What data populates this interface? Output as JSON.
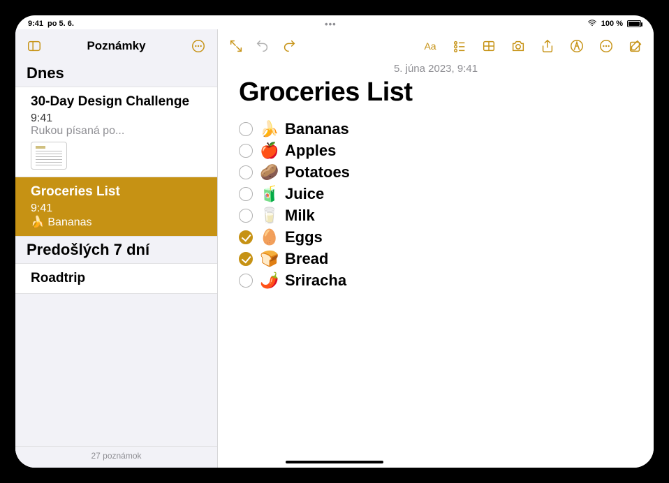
{
  "statusbar": {
    "time": "9:41",
    "date": "po 5. 6.",
    "battery_text": "100 %"
  },
  "sidebar": {
    "title": "Poznámky",
    "sections": [
      {
        "header": "Dnes",
        "items": [
          {
            "title": "30-Day Design Challenge",
            "time": "9:41",
            "preview": "Rukou písaná po...",
            "has_thumb": true,
            "selected": false
          },
          {
            "title": "Groceries List",
            "time": "9:41",
            "preview": "🍌 Bananas",
            "has_thumb": false,
            "selected": true
          }
        ]
      },
      {
        "header": "Predošlých 7 dní",
        "items": [
          {
            "title": "Roadtrip",
            "time": "",
            "preview": "",
            "has_thumb": false,
            "selected": false
          }
        ]
      }
    ],
    "footer": "27 poznámok"
  },
  "note": {
    "date": "5. júna 2023, 9:41",
    "title": "Groceries List",
    "items": [
      {
        "emoji": "🍌",
        "label": "Bananas",
        "checked": false
      },
      {
        "emoji": "🍎",
        "label": "Apples",
        "checked": false
      },
      {
        "emoji": "🥔",
        "label": "Potatoes",
        "checked": false
      },
      {
        "emoji": "🧃",
        "label": "Juice",
        "checked": false
      },
      {
        "emoji": "🥛",
        "label": "Milk",
        "checked": false
      },
      {
        "emoji": "🥚",
        "label": "Eggs",
        "checked": true
      },
      {
        "emoji": "🍞",
        "label": "Bread",
        "checked": true
      },
      {
        "emoji": "🌶️",
        "label": "Sriracha",
        "checked": false
      }
    ]
  },
  "toolbar": {
    "format_label": "Aa"
  }
}
